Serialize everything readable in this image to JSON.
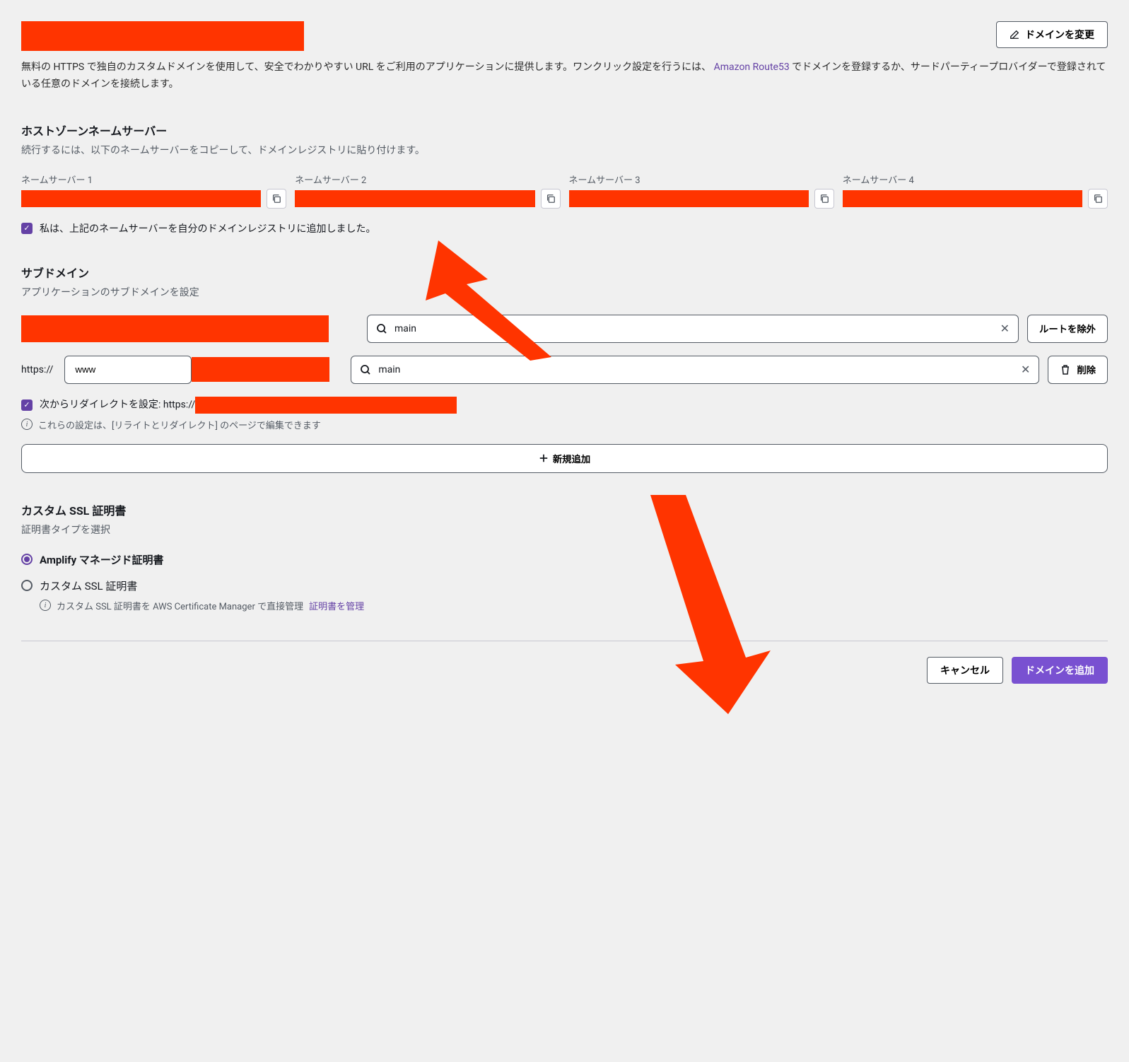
{
  "header": {
    "change_domain_label": "ドメインを変更"
  },
  "description": {
    "text": "無料の HTTPS で独自のカスタムドメインを使用して、安全でわかりやすい URL をご利用のアプリケーションに提供します。ワンクリック設定を行うには、",
    "link_text": "Amazon Route53",
    "text_after": " でドメインを登録するか、サードパーティープロバイダーで登録されている任意のドメインを接続します。"
  },
  "nameservers": {
    "title": "ホストゾーンネームサーバー",
    "desc": "続行するには、以下のネームサーバーをコピーして、ドメインレジストリに貼り付けます。",
    "labels": [
      "ネームサーバー 1",
      "ネームサーバー 2",
      "ネームサーバー 3",
      "ネームサーバー 4"
    ],
    "confirm_label": "私は、上記のネームサーバーを自分のドメインレジストリに追加しました。"
  },
  "subdomain": {
    "title": "サブドメイン",
    "desc": "アプリケーションのサブドメインを設定",
    "branch1": "main",
    "exclude_btn": "ルートを除外",
    "https_label": "https://",
    "www_value": "www",
    "branch2": "main",
    "delete_btn": "削除",
    "redirect_label": "次からリダイレクトを設定: https://",
    "info_text": "これらの設定は、[リライトとリダイレクト] のページで編集できます",
    "add_new_btn": "新規追加"
  },
  "ssl": {
    "title": "カスタム SSL 証明書",
    "desc": "証明書タイプを選択",
    "option1": "Amplify マネージド証明書",
    "option2": "カスタム SSL 証明書",
    "cert_info": "カスタム SSL 証明書を AWS Certificate Manager で直接管理",
    "cert_link": "証明書を管理"
  },
  "footer": {
    "cancel": "キャンセル",
    "add_domain": "ドメインを追加"
  }
}
